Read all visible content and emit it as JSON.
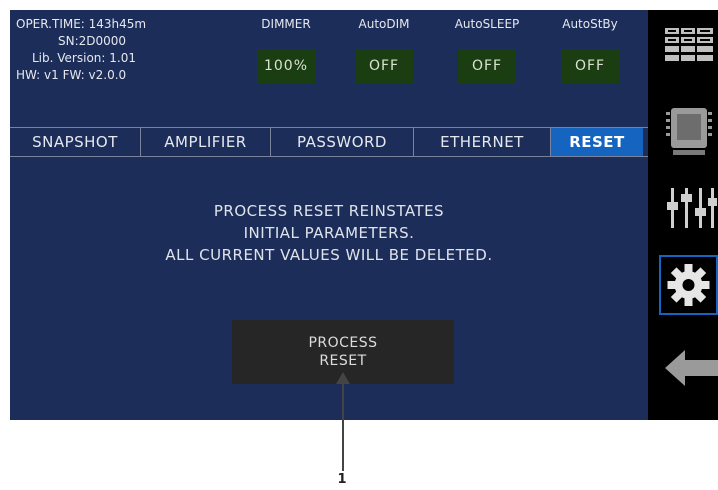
{
  "info": {
    "oper_time": "OPER.TIME: 143h45m",
    "sn": "SN:2D0000",
    "lib_version": "Lib. Version: 1.01",
    "hw_fw": "HW: v1  FW: v2.0.0"
  },
  "controls": [
    {
      "label": "DIMMER",
      "value": "100%"
    },
    {
      "label": "AutoDIM",
      "value": "OFF"
    },
    {
      "label": "AutoSLEEP",
      "value": "OFF"
    },
    {
      "label": "AutoStBy",
      "value": "OFF"
    }
  ],
  "tabs": [
    {
      "label": "SNAPSHOT"
    },
    {
      "label": "AMPLIFIER"
    },
    {
      "label": "PASSWORD"
    },
    {
      "label": "ETHERNET"
    },
    {
      "label": "RESET"
    }
  ],
  "active_tab": "RESET",
  "message": [
    "PROCESS RESET REINSTATES",
    "INITIAL PARAMETERS.",
    "ALL CURRENT VALUES WILL BE DELETED."
  ],
  "process_button": {
    "line1": "PROCESS",
    "line2": "RESET"
  },
  "sidebar": {
    "icons": [
      "channel-grid-icon",
      "processor-chip-icon",
      "faders-icon",
      "gear-icon",
      "back-arrow-icon"
    ],
    "active": "gear-icon"
  },
  "callout": "1",
  "colors": {
    "panel": "#1c2d5a",
    "accent": "#1565c0",
    "value_box": "#1a3d12",
    "button": "#262626"
  }
}
